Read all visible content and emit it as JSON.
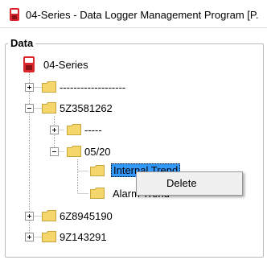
{
  "window": {
    "title": "04-Series - Data Logger Management Program [P."
  },
  "panel": {
    "legend": "Data"
  },
  "tree": {
    "root": {
      "label": "04-Series"
    },
    "nodes": [
      {
        "label": "-------------------"
      },
      {
        "label": "5Z3581262"
      },
      {
        "label": "-----"
      },
      {
        "label": "05/20"
      },
      {
        "label": "Internal Trend"
      },
      {
        "label": "Alarm Trend"
      },
      {
        "label": "6Z8945190"
      },
      {
        "label": "9Z143291"
      }
    ]
  },
  "context_menu": {
    "items": [
      {
        "label": "Delete"
      }
    ]
  },
  "colors": {
    "selection": "#3399ff",
    "folder": "#f5d66b",
    "app_icon": "#d9262c"
  }
}
